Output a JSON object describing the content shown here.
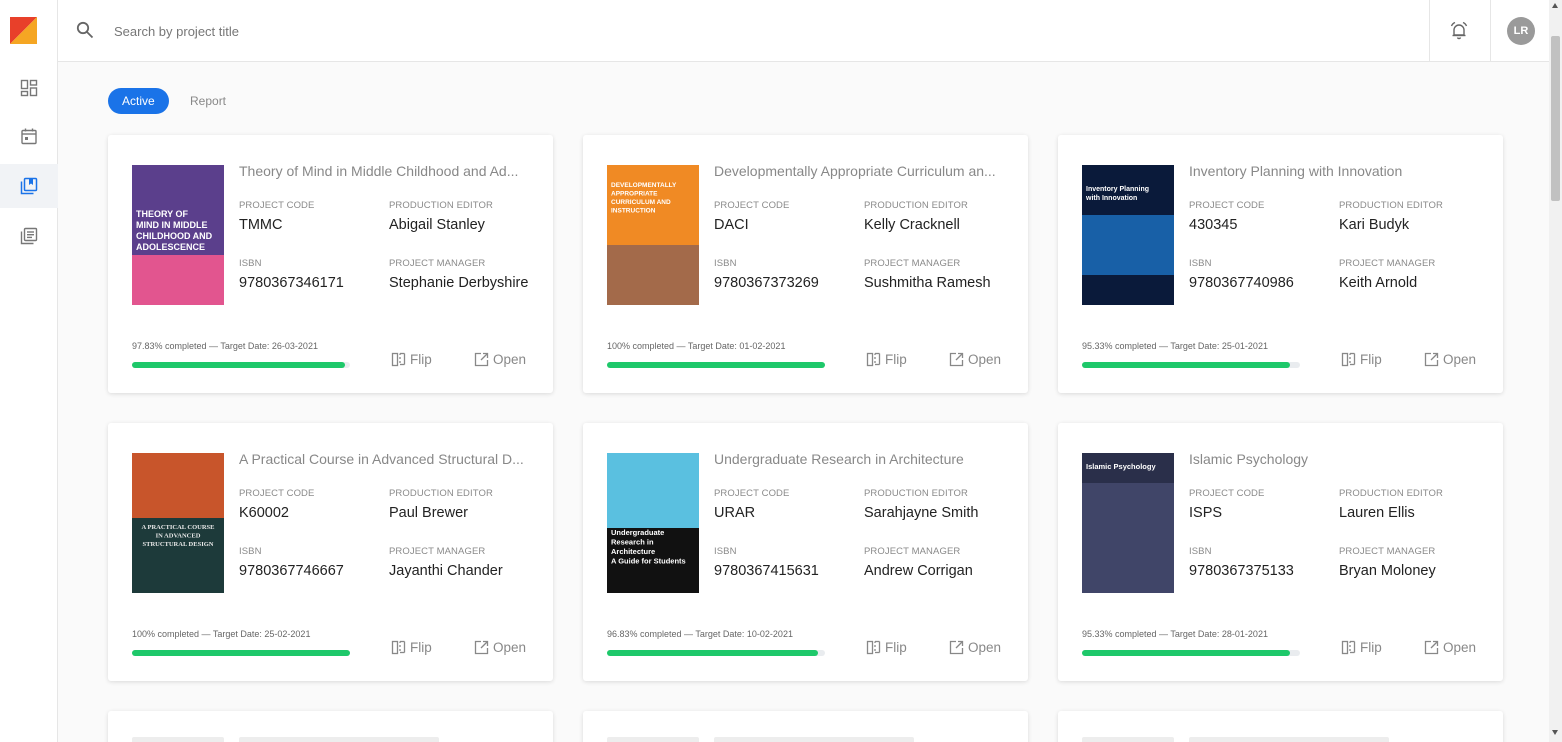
{
  "search": {
    "placeholder": "Search by project title"
  },
  "user": {
    "initials": "LR"
  },
  "tabs": [
    {
      "label": "Active"
    },
    {
      "label": "Report"
    }
  ],
  "labels": {
    "project_code": "PROJECT CODE",
    "production_editor": "PRODUCTION EDITOR",
    "isbn": "ISBN",
    "project_manager": "PROJECT MANAGER",
    "flip": "Flip",
    "open": "Open"
  },
  "colors": {
    "accent": "#1a73e8",
    "progress": "#1ec86a",
    "logo_orange": "#f5a623",
    "logo_red": "#e8402a"
  },
  "icons": {
    "sidebar": [
      "dashboard-icon",
      "calendar-icon",
      "books-icon",
      "document-list-icon"
    ],
    "topbar": [
      "search-icon",
      "alarm-bell-icon"
    ]
  },
  "projects": [
    {
      "title": "Theory of Mind in Middle Childhood and Ad...",
      "code": "TMMC",
      "editor": "Abigail Stanley",
      "isbn": "9780367346171",
      "manager": "Stephanie Derbyshire",
      "progress_text": "97.83% completed — Target Date: 26-03-2021",
      "progress": 97.83
    },
    {
      "title": "Developmentally Appropriate Curriculum an...",
      "code": "DACI",
      "editor": "Kelly Cracknell",
      "isbn": "9780367373269",
      "manager": "Sushmitha Ramesh",
      "progress_text": "100% completed — Target Date: 01-02-2021",
      "progress": 100
    },
    {
      "title": "Inventory Planning with Innovation",
      "code": "430345",
      "editor": "Kari Budyk",
      "isbn": "9780367740986",
      "manager": "Keith Arnold",
      "progress_text": "95.33% completed — Target Date: 25-01-2021",
      "progress": 95.33
    },
    {
      "title": "A Practical Course in Advanced Structural D...",
      "code": "K60002",
      "editor": "Paul Brewer",
      "isbn": "9780367746667",
      "manager": "Jayanthi Chander",
      "progress_text": "100% completed — Target Date: 25-02-2021",
      "progress": 100
    },
    {
      "title": "Undergraduate Research in Architecture",
      "code": "URAR",
      "editor": "Sarahjayne Smith",
      "isbn": "9780367415631",
      "manager": "Andrew Corrigan",
      "progress_text": "96.83% completed — Target Date: 10-02-2021",
      "progress": 96.83
    },
    {
      "title": "Islamic Psychology",
      "code": "ISPS",
      "editor": "Lauren Ellis",
      "isbn": "9780367375133",
      "manager": "Bryan Moloney",
      "progress_text": "95.33% completed — Target Date: 28-01-2021",
      "progress": 95.33
    }
  ],
  "covers": [
    {
      "lines": [
        "THEORY OF",
        "MIND IN MIDDLE",
        "CHILDHOOD AND",
        "ADOLESCENCE"
      ]
    },
    {
      "lines": [
        "DEVELOPMENTALLY",
        "APPROPRIATE",
        "CURRICULUM AND",
        "INSTRUCTION"
      ]
    },
    {
      "lines": [
        "Inventory Planning",
        "with Innovation"
      ]
    },
    {
      "lines": [
        "A PRACTICAL COURSE",
        "IN ADVANCED",
        "STRUCTURAL DESIGN"
      ]
    },
    {
      "lines": [
        "Undergraduate",
        "Research in",
        "Architecture",
        "A Guide for Students"
      ]
    },
    {
      "lines": [
        "Islamic Psychology"
      ]
    }
  ]
}
